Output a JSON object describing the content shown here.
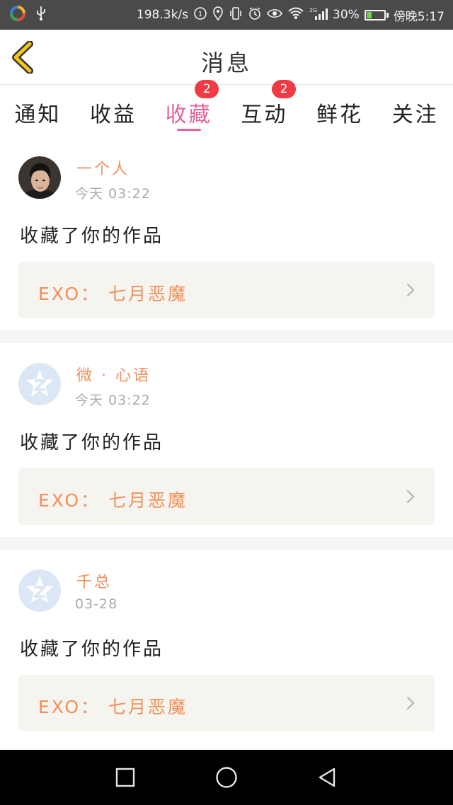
{
  "status_bar": {
    "speed": "198.3k/s",
    "network": "2G",
    "battery": "30%",
    "battery_level": 0.3,
    "time": "傍晚5:17"
  },
  "header": {
    "back_icon": "chevron-left-icon",
    "title": "消息"
  },
  "tabs": [
    {
      "label": "通知",
      "badge": ""
    },
    {
      "label": "收益",
      "badge": ""
    },
    {
      "label": "收藏",
      "badge": "2",
      "active": true
    },
    {
      "label": "互动",
      "badge": "2"
    },
    {
      "label": "鲜花",
      "badge": ""
    },
    {
      "label": "关注",
      "badge": ""
    }
  ],
  "feed": [
    {
      "username": "一个人",
      "time": "今天  03:22",
      "action": "收藏了你的作品",
      "work": "EXO： 七月恶魔",
      "avatar": "photo"
    },
    {
      "username": "微 · 心语",
      "time": "今天  03:22",
      "action": "收藏了你的作品",
      "work": "EXO： 七月恶魔",
      "avatar": "qq-default"
    },
    {
      "username": "千总",
      "time": "03-28",
      "action": "收藏了你的作品",
      "work": "EXO： 七月恶魔",
      "avatar": "qq-default"
    }
  ],
  "colors": {
    "accent_pink": "#e8629a",
    "orange_text": "#f0905c",
    "badge_red": "#ee3b45",
    "back_yellow": "#f5c518"
  },
  "navbar": {
    "icons": [
      "square-recents-icon",
      "circle-home-icon",
      "triangle-back-icon"
    ]
  }
}
